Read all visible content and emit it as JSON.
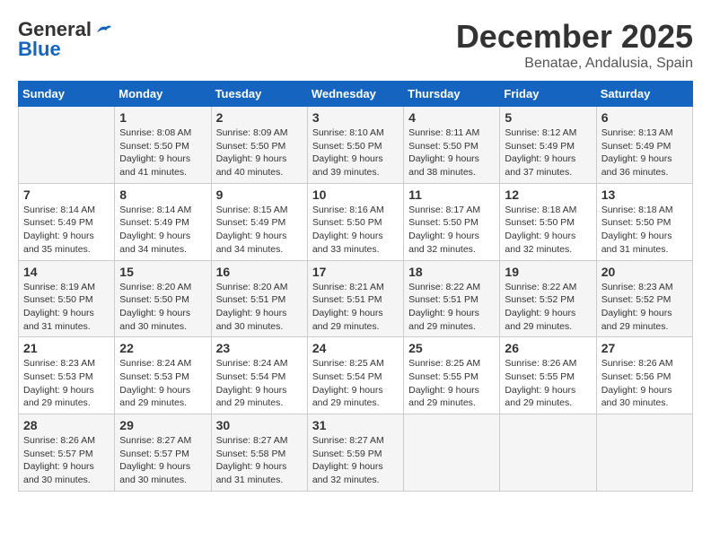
{
  "logo": {
    "line1": "General",
    "line2": "Blue"
  },
  "title": "December 2025",
  "location": "Benatae, Andalusia, Spain",
  "days_of_week": [
    "Sunday",
    "Monday",
    "Tuesday",
    "Wednesday",
    "Thursday",
    "Friday",
    "Saturday"
  ],
  "weeks": [
    [
      {
        "day": "",
        "info": ""
      },
      {
        "day": "1",
        "info": "Sunrise: 8:08 AM\nSunset: 5:50 PM\nDaylight: 9 hours\nand 41 minutes."
      },
      {
        "day": "2",
        "info": "Sunrise: 8:09 AM\nSunset: 5:50 PM\nDaylight: 9 hours\nand 40 minutes."
      },
      {
        "day": "3",
        "info": "Sunrise: 8:10 AM\nSunset: 5:50 PM\nDaylight: 9 hours\nand 39 minutes."
      },
      {
        "day": "4",
        "info": "Sunrise: 8:11 AM\nSunset: 5:50 PM\nDaylight: 9 hours\nand 38 minutes."
      },
      {
        "day": "5",
        "info": "Sunrise: 8:12 AM\nSunset: 5:49 PM\nDaylight: 9 hours\nand 37 minutes."
      },
      {
        "day": "6",
        "info": "Sunrise: 8:13 AM\nSunset: 5:49 PM\nDaylight: 9 hours\nand 36 minutes."
      }
    ],
    [
      {
        "day": "7",
        "info": "Sunrise: 8:14 AM\nSunset: 5:49 PM\nDaylight: 9 hours\nand 35 minutes."
      },
      {
        "day": "8",
        "info": "Sunrise: 8:14 AM\nSunset: 5:49 PM\nDaylight: 9 hours\nand 34 minutes."
      },
      {
        "day": "9",
        "info": "Sunrise: 8:15 AM\nSunset: 5:49 PM\nDaylight: 9 hours\nand 34 minutes."
      },
      {
        "day": "10",
        "info": "Sunrise: 8:16 AM\nSunset: 5:50 PM\nDaylight: 9 hours\nand 33 minutes."
      },
      {
        "day": "11",
        "info": "Sunrise: 8:17 AM\nSunset: 5:50 PM\nDaylight: 9 hours\nand 32 minutes."
      },
      {
        "day": "12",
        "info": "Sunrise: 8:18 AM\nSunset: 5:50 PM\nDaylight: 9 hours\nand 32 minutes."
      },
      {
        "day": "13",
        "info": "Sunrise: 8:18 AM\nSunset: 5:50 PM\nDaylight: 9 hours\nand 31 minutes."
      }
    ],
    [
      {
        "day": "14",
        "info": "Sunrise: 8:19 AM\nSunset: 5:50 PM\nDaylight: 9 hours\nand 31 minutes."
      },
      {
        "day": "15",
        "info": "Sunrise: 8:20 AM\nSunset: 5:50 PM\nDaylight: 9 hours\nand 30 minutes."
      },
      {
        "day": "16",
        "info": "Sunrise: 8:20 AM\nSunset: 5:51 PM\nDaylight: 9 hours\nand 30 minutes."
      },
      {
        "day": "17",
        "info": "Sunrise: 8:21 AM\nSunset: 5:51 PM\nDaylight: 9 hours\nand 29 minutes."
      },
      {
        "day": "18",
        "info": "Sunrise: 8:22 AM\nSunset: 5:51 PM\nDaylight: 9 hours\nand 29 minutes."
      },
      {
        "day": "19",
        "info": "Sunrise: 8:22 AM\nSunset: 5:52 PM\nDaylight: 9 hours\nand 29 minutes."
      },
      {
        "day": "20",
        "info": "Sunrise: 8:23 AM\nSunset: 5:52 PM\nDaylight: 9 hours\nand 29 minutes."
      }
    ],
    [
      {
        "day": "21",
        "info": "Sunrise: 8:23 AM\nSunset: 5:53 PM\nDaylight: 9 hours\nand 29 minutes."
      },
      {
        "day": "22",
        "info": "Sunrise: 8:24 AM\nSunset: 5:53 PM\nDaylight: 9 hours\nand 29 minutes."
      },
      {
        "day": "23",
        "info": "Sunrise: 8:24 AM\nSunset: 5:54 PM\nDaylight: 9 hours\nand 29 minutes."
      },
      {
        "day": "24",
        "info": "Sunrise: 8:25 AM\nSunset: 5:54 PM\nDaylight: 9 hours\nand 29 minutes."
      },
      {
        "day": "25",
        "info": "Sunrise: 8:25 AM\nSunset: 5:55 PM\nDaylight: 9 hours\nand 29 minutes."
      },
      {
        "day": "26",
        "info": "Sunrise: 8:26 AM\nSunset: 5:55 PM\nDaylight: 9 hours\nand 29 minutes."
      },
      {
        "day": "27",
        "info": "Sunrise: 8:26 AM\nSunset: 5:56 PM\nDaylight: 9 hours\nand 30 minutes."
      }
    ],
    [
      {
        "day": "28",
        "info": "Sunrise: 8:26 AM\nSunset: 5:57 PM\nDaylight: 9 hours\nand 30 minutes."
      },
      {
        "day": "29",
        "info": "Sunrise: 8:27 AM\nSunset: 5:57 PM\nDaylight: 9 hours\nand 30 minutes."
      },
      {
        "day": "30",
        "info": "Sunrise: 8:27 AM\nSunset: 5:58 PM\nDaylight: 9 hours\nand 31 minutes."
      },
      {
        "day": "31",
        "info": "Sunrise: 8:27 AM\nSunset: 5:59 PM\nDaylight: 9 hours\nand 32 minutes."
      },
      {
        "day": "",
        "info": ""
      },
      {
        "day": "",
        "info": ""
      },
      {
        "day": "",
        "info": ""
      }
    ]
  ]
}
